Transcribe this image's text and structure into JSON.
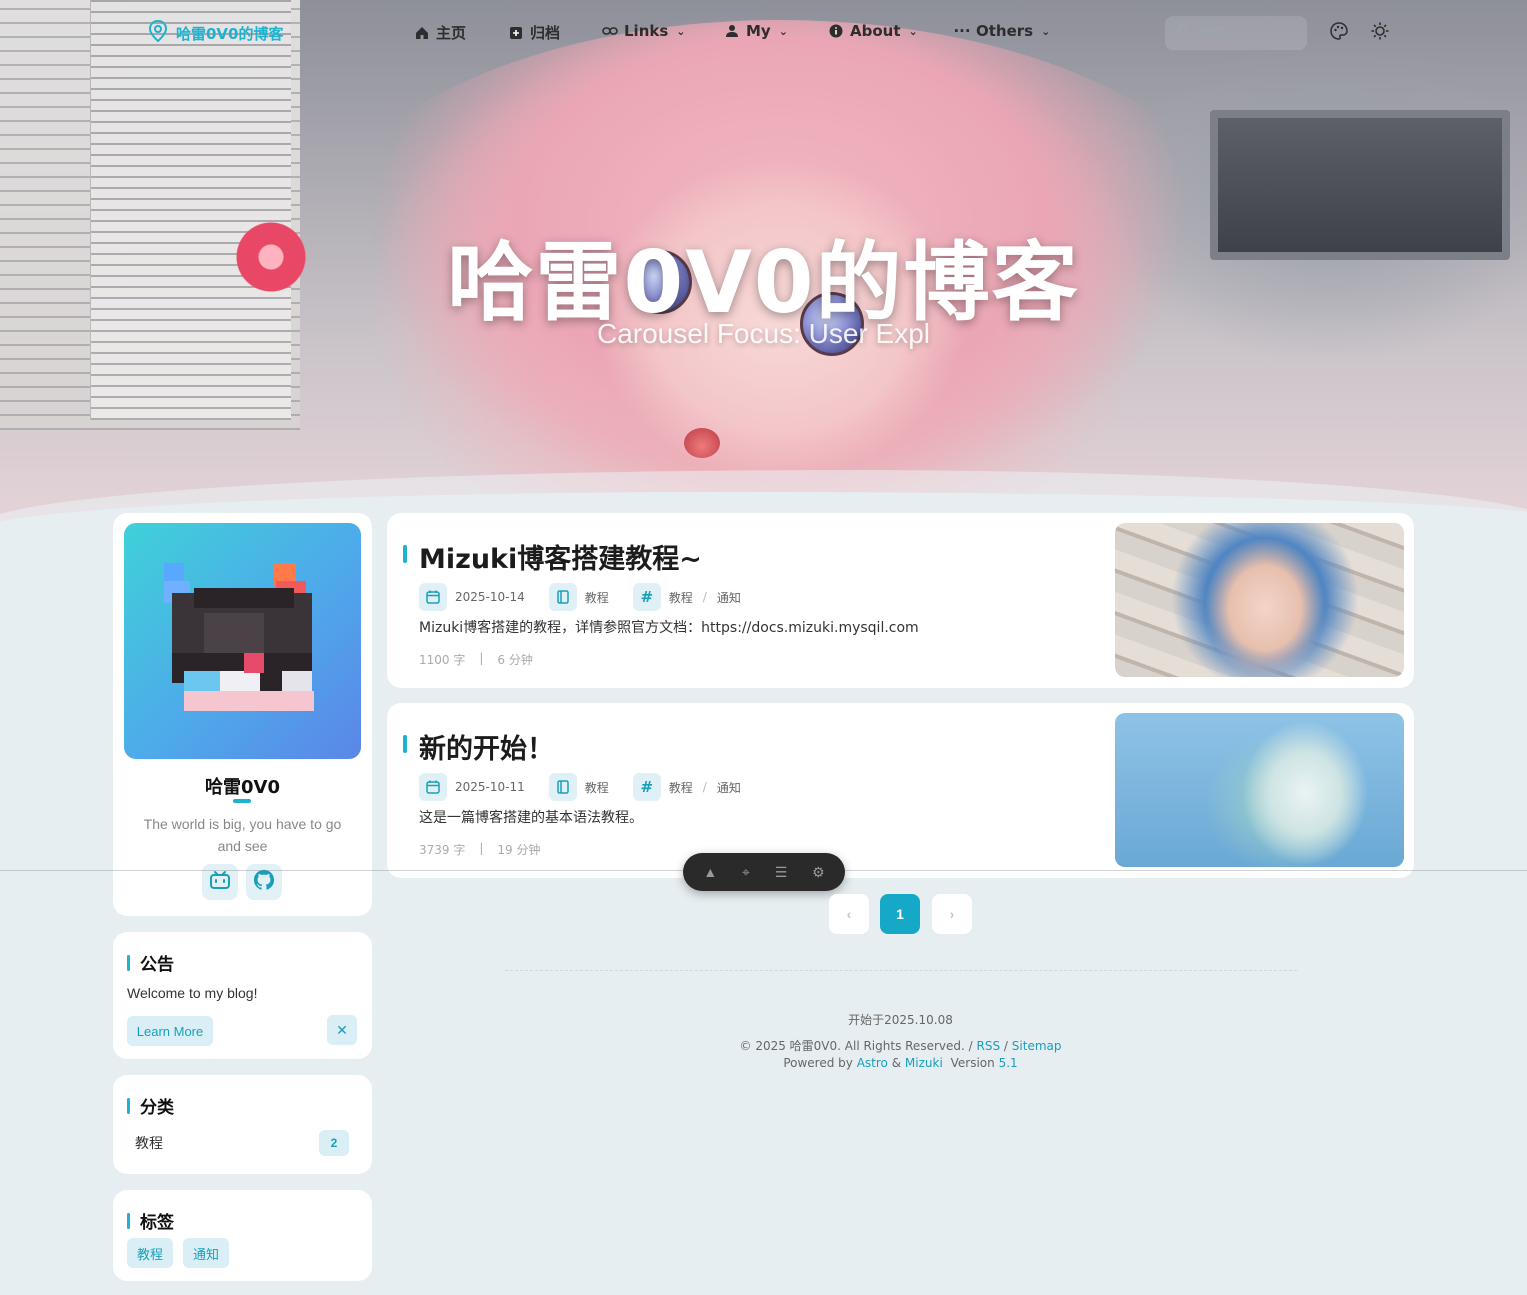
{
  "navbar": {
    "brand": "哈雷0V0的博客",
    "items": [
      {
        "label": "主页",
        "icon": "home-icon"
      },
      {
        "label": "归档",
        "icon": "archive-icon"
      },
      {
        "label": "Links",
        "icon": "link-icon"
      },
      {
        "label": "My",
        "icon": "user-icon"
      },
      {
        "label": "About",
        "icon": "info-icon"
      },
      {
        "label": "Others",
        "icon": "more-icon"
      }
    ],
    "search_placeholder": "搜索"
  },
  "hero": {
    "title": "哈雷0V0的博客",
    "subtitle": "Carousel Focus: User Expl"
  },
  "profile": {
    "name": "哈雷0V0",
    "bio": "The world is big, you have to go and see"
  },
  "notice": {
    "title": "公告",
    "text": "Welcome to my blog!",
    "learn_more": "Learn More",
    "close": "✕"
  },
  "categories": {
    "title": "分类",
    "items": [
      {
        "name": "教程",
        "count": "2"
      }
    ]
  },
  "tags": {
    "title": "标签",
    "items": [
      "教程",
      "通知"
    ]
  },
  "posts": [
    {
      "title": "Mizuki博客搭建教程~",
      "date": "2025-10-14",
      "category": "教程",
      "tags": [
        "教程",
        "通知"
      ],
      "description": "Mizuki博客搭建的教程，详情参照官方文档：https://docs.mizuki.mysqil.com",
      "words": "1100 字",
      "read_time": "6 分钟"
    },
    {
      "title": "新的开始！",
      "date": "2025-10-11",
      "category": "教程",
      "tags": [
        "教程",
        "通知"
      ],
      "description": "这是一篇博客搭建的基本语法教程。",
      "words": "3739 字",
      "read_time": "19 分钟"
    }
  ],
  "pagination": {
    "prev": "‹",
    "current": "1",
    "next": "›"
  },
  "footer": {
    "started": "开始于2025.10.08",
    "copyright": "© 2025 哈雷0V0. All Rights Reserved. /",
    "rss": "RSS",
    "slash": "/",
    "sitemap": "Sitemap",
    "powered_by": "Powered by",
    "astro": "Astro",
    "amp": "&",
    "mizuki": "Mizuki",
    "version_label": "Version",
    "version": "5.1"
  },
  "colors": {
    "accent": "#1db3d0",
    "background": "#e6eef1"
  }
}
